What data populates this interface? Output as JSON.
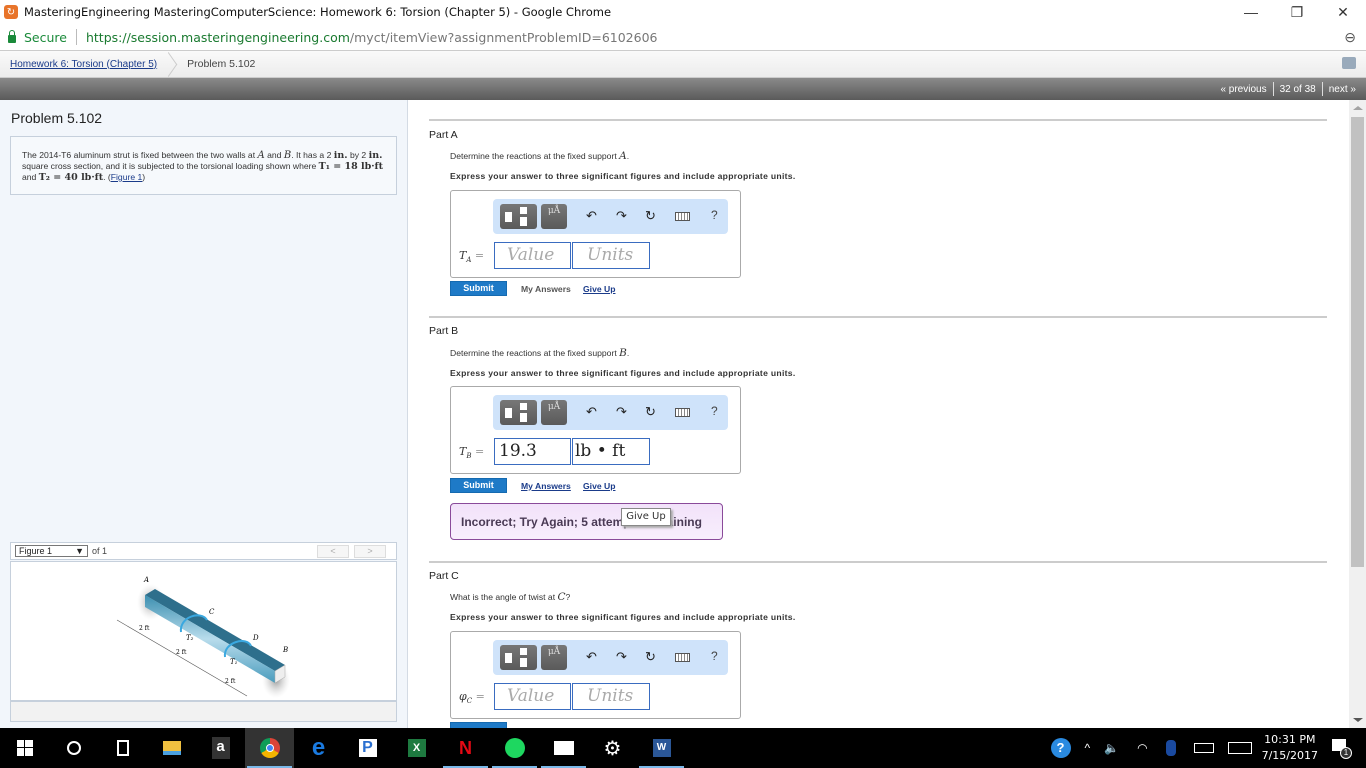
{
  "browser": {
    "window_title": "MasteringEngineering MasteringComputerScience: Homework 6: Torsion (Chapter 5) - Google Chrome",
    "secure_label": "Secure",
    "url_host": "https://session.masteringengineering.com",
    "url_path": "/myct/itemView?assignmentProblemID=6102606",
    "minimize": "—",
    "restore": "❐",
    "close": "✕",
    "zoom_icon": "🔍"
  },
  "breadcrumb": {
    "assignment": "Homework 6: Torsion (Chapter 5)",
    "current": "Problem 5.102"
  },
  "nav": {
    "previous": "« previous",
    "position": "32 of 38",
    "next": "next »"
  },
  "problem": {
    "title": "Problem 5.102",
    "text_1": "The 2014-T6 aluminum strut is fixed between the two walls at ",
    "A": "A",
    "and": " and ",
    "B": "B",
    "text_2": ". It has a 2 ",
    "in1": "in.",
    "text_3": " by 2 ",
    "in2": "in.",
    "text_4": " square cross section, and it is subjected to the torsional loading shown where ",
    "T1": "T₁ = 18 lb·ft",
    "text_5": " and ",
    "T2": "T₂ = 40 lb·ft",
    "text_6": ". (",
    "figure_link": "Figure 1",
    "text_7": ")"
  },
  "figure": {
    "selector": "Figure 1",
    "arrow": "▼",
    "of": "of 1",
    "prev": "<",
    "next": ">",
    "labels": {
      "A": "A",
      "B": "B",
      "C": "C",
      "D": "D",
      "T1": "T₁",
      "T2": "T₂",
      "d1": "2 ft",
      "d2": "2 ft",
      "d3": "2 ft"
    }
  },
  "parts": [
    {
      "label": "Part A",
      "question": "Determine the reactions at the fixed support ",
      "symbol": "A",
      "question_end": ".",
      "instruction": "Express your answer to three significant figures and include appropriate units.",
      "lhs": "T",
      "lhs_sub": "A",
      "value": "",
      "value_placeholder": "Value",
      "units": "",
      "units_placeholder": "Units",
      "submit": "Submit",
      "my_answers": "My Answers",
      "give_up": "Give Up"
    },
    {
      "label": "Part B",
      "question": "Determine the reactions at the fixed support ",
      "symbol": "B",
      "question_end": ".",
      "instruction": "Express your answer to three significant figures and include appropriate units.",
      "lhs": "T",
      "lhs_sub": "B",
      "value": "19.3",
      "units": "lb • ft",
      "submit": "Submit",
      "my_answers": "My Answers",
      "give_up": "Give Up",
      "feedback": "Incorrect; Try Again; 5 attempts remaining",
      "tooltip": "Give Up"
    },
    {
      "label": "Part C",
      "question": "What is the angle of twist at ",
      "symbol": "C",
      "question_end": "?",
      "instruction": "Express your answer to three significant figures and include appropriate units.",
      "lhs": "φ",
      "lhs_sub": "C",
      "value": "",
      "value_placeholder": "Value",
      "units": "",
      "units_placeholder": "Units"
    }
  ],
  "toolbar": {
    "templates": "templates",
    "symbols": "μÅ",
    "undo": "↶",
    "redo": "↷",
    "reset": "↻",
    "help": "?",
    "equals": "="
  },
  "taskbar": {
    "time": "10:31 PM",
    "date": "7/15/2017",
    "notifications": "1"
  }
}
